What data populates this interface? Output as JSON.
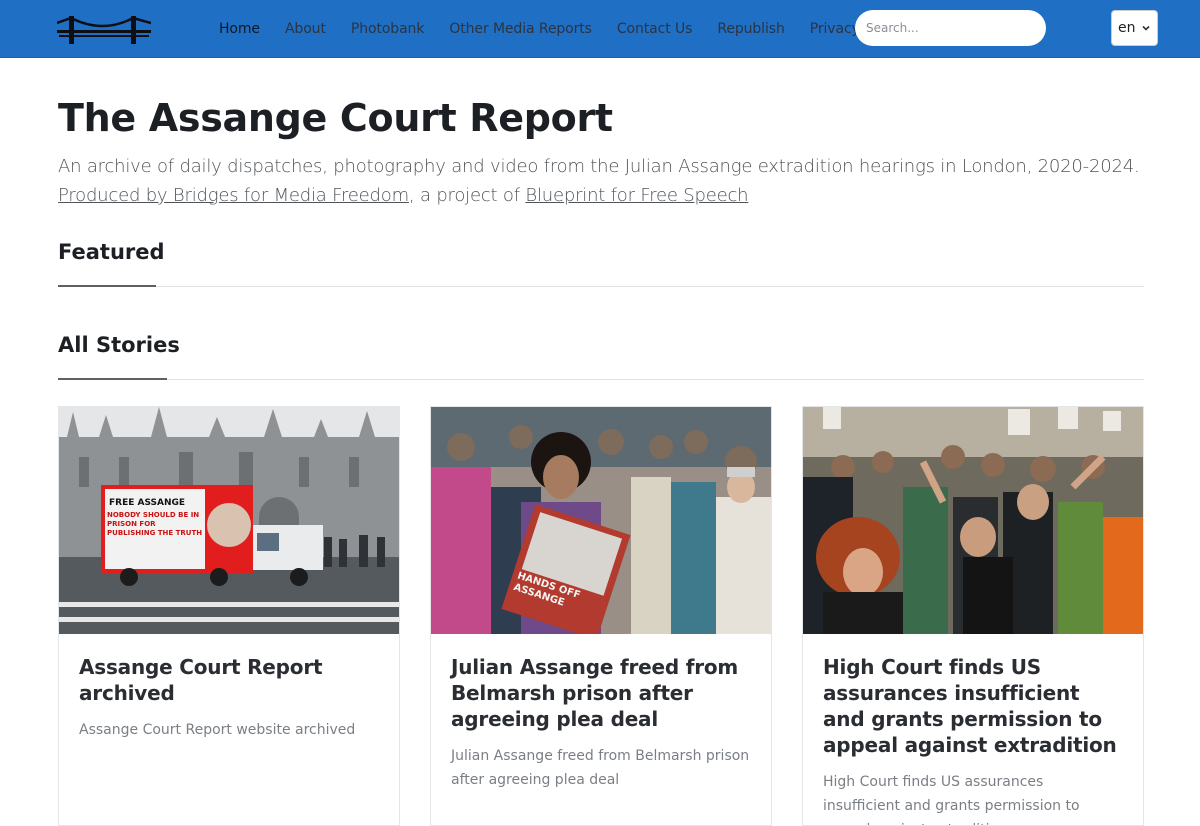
{
  "nav": {
    "links": [
      {
        "label": "Home",
        "active": true
      },
      {
        "label": "About"
      },
      {
        "label": "Photobank"
      },
      {
        "label": "Other Media Reports"
      },
      {
        "label": "Contact Us"
      },
      {
        "label": "Republish"
      },
      {
        "label": "Privacy"
      }
    ],
    "search_placeholder": "Search...",
    "language": "en"
  },
  "hero": {
    "title": "The Assange Court Report",
    "lead_text": "An archive of daily dispatches, photography and video from the Julian Assange extradition hearings in London, 2020-2024.",
    "produced_by_link": "Produced by Bridges for Media Freedom",
    "project_of_text": ", a project of ",
    "blueprint_link": "Blueprint for Free Speech"
  },
  "sections": {
    "featured": "Featured",
    "all_stories": "All Stories"
  },
  "stories": [
    {
      "title": "Assange Court Report archived",
      "excerpt": "Assange Court Report website archived",
      "truck_sign_line1": "FREE ASSANGE",
      "truck_sign_line2": "NOBODY SHOULD BE IN PRISON FOR PUBLISHING THE TRUTH"
    },
    {
      "title": "Julian Assange freed from Belmarsh prison after agreeing plea deal",
      "excerpt": "Julian Assange freed from Belmarsh prison after agreeing plea deal",
      "placard_text": "HANDS OFF ASSANGE"
    },
    {
      "title": "High Court finds US assurances insufficient and grants permission to appeal against extradition",
      "excerpt": "High Court finds US assurances insufficient and grants permission to appeal against extradition"
    }
  ],
  "colors": {
    "navbar": "#1f6fc5",
    "text_dark": "#1c1f23",
    "lead": "#505458",
    "muted": "#7a7f85"
  },
  "icons": {
    "brand": "bridge-logo-icon",
    "lang": "chevron-down-icon"
  }
}
